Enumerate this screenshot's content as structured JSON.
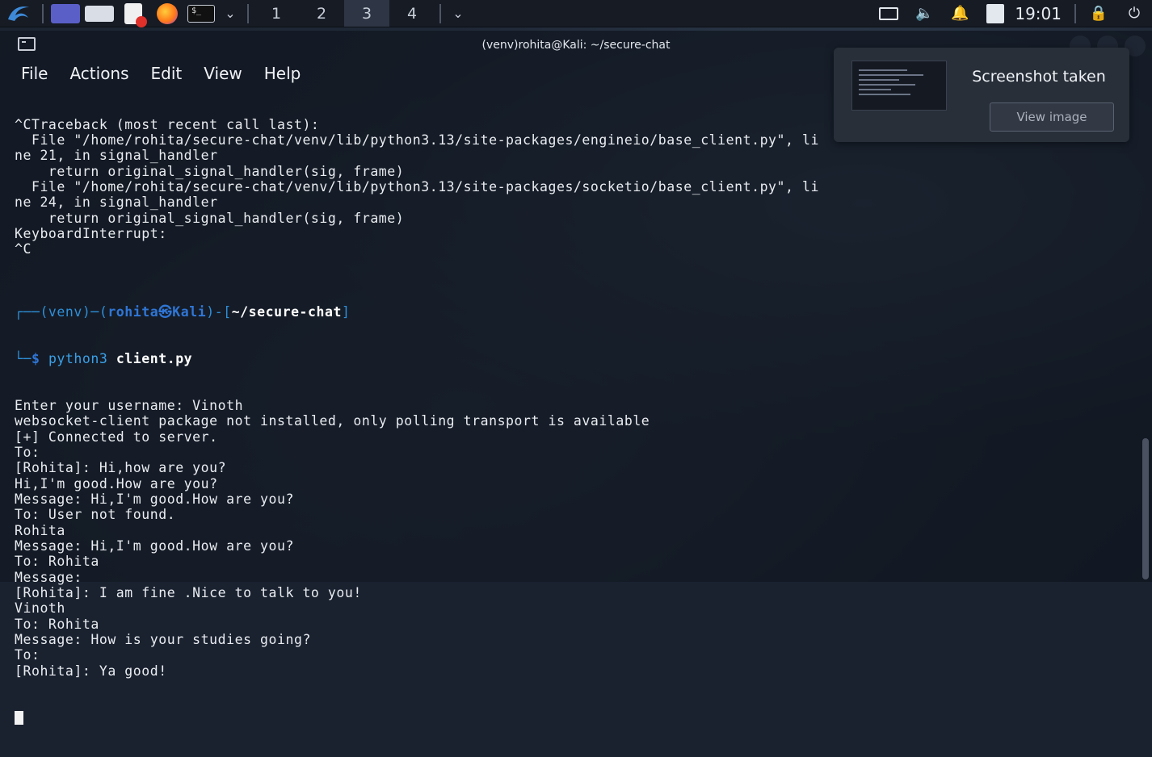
{
  "panel": {
    "desktops": [
      "1",
      "2",
      "3",
      "4"
    ],
    "active_desktop": 3,
    "clock": "19:01",
    "icons": [
      "kali-menu-icon",
      "desktop-icon",
      "file-manager-icon",
      "text-editor-icon",
      "firefox-icon",
      "terminal-icon",
      "chevron-down-icon",
      "monitor-icon",
      "volume-icon",
      "bell-icon",
      "clipboard-icon",
      "lock-icon",
      "power-icon"
    ]
  },
  "window": {
    "title": "(venv)rohita@Kali: ~/secure-chat",
    "menu": [
      "File",
      "Actions",
      "Edit",
      "View",
      "Help"
    ]
  },
  "notification": {
    "title": "Screenshot taken",
    "button": "View image"
  },
  "terminal": {
    "pre_lines": [
      "^CTraceback (most recent call last):",
      "  File \"/home/rohita/secure-chat/venv/lib/python3.13/site-packages/engineio/base_client.py\", li",
      "ne 21, in signal_handler",
      "    return original_signal_handler(sig, frame)",
      "  File \"/home/rohita/secure-chat/venv/lib/python3.13/site-packages/socketio/base_client.py\", li",
      "ne 24, in signal_handler",
      "    return original_signal_handler(sig, frame)",
      "KeyboardInterrupt:",
      "^C",
      ""
    ],
    "prompt": {
      "venv": "(venv)",
      "user": "rohita",
      "at": "㉿",
      "host": "Kali",
      "path": "~/secure-chat",
      "cmd": "python3",
      "arg": "client.py"
    },
    "post_lines": [
      "Enter your username: Vinoth",
      "websocket-client package not installed, only polling transport is available",
      "[+] Connected to server.",
      "To: ",
      "[Rohita]: Hi,how are you?",
      "Hi,I'm good.How are you?",
      "Message: Hi,I'm good.How are you?",
      "To: User not found.",
      "Rohita",
      "Message: Hi,I'm good.How are you?",
      "To: Rohita",
      "Message: ",
      "[Rohita]: I am fine .Nice to talk to you!",
      "Vinoth",
      "To: Rohita",
      "Message: How is your studies going?",
      "To: ",
      "[Rohita]: Ya good!"
    ]
  }
}
